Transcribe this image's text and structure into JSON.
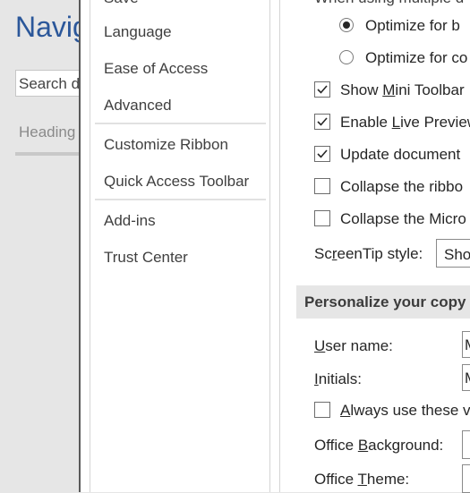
{
  "nav": {
    "title": "Navig",
    "search_placeholder": "Search d",
    "tab_headings": "Heading"
  },
  "categories": {
    "top_cut": "Save",
    "items": [
      "Language",
      "Ease of Access",
      "Advanced",
      "Customize Ribbon",
      "Quick Access Toolbar",
      "Add-ins",
      "Trust Center"
    ]
  },
  "options": {
    "top_cut": "When using multiple d",
    "radio_optimize_best": "Optimize for b",
    "radio_optimize_compat": "Optimize for co",
    "show_mini_toolbar_pre": "Show ",
    "show_mini_toolbar_u": "M",
    "show_mini_toolbar_post": "ini Toolbar",
    "enable_live_preview_pre": "Enable ",
    "enable_live_preview_u": "L",
    "enable_live_preview_post": "ive Preview",
    "update_document": "Update document",
    "collapse_ribbon": "Collapse the ribbo",
    "collapse_microsoft": "Collapse the Micro",
    "screentip_pre": "Sc",
    "screentip_u": "r",
    "screentip_post": "eenTip style:",
    "screentip_value": "Sho"
  },
  "personalize": {
    "header": "Personalize your copy",
    "user_name_u": "U",
    "user_name_post": "ser name:",
    "user_name_value": "M",
    "initials_u": "I",
    "initials_post": "nitials:",
    "initials_value": "M",
    "always_use_u": "A",
    "always_use_post": "lways use these v",
    "office_background_pre": "Office ",
    "office_background_u": "B",
    "office_background_post": "ackground:",
    "office_theme_pre": "Office ",
    "office_theme_u": "T",
    "office_theme_post": "heme:"
  },
  "checkbox_states": {
    "show_mini_toolbar": true,
    "enable_live_preview": true,
    "update_document": true,
    "collapse_ribbon": false,
    "collapse_microsoft": false,
    "always_use": false
  },
  "colors": {
    "accent": "#2b579a",
    "section_bg": "#e6e6e6"
  }
}
